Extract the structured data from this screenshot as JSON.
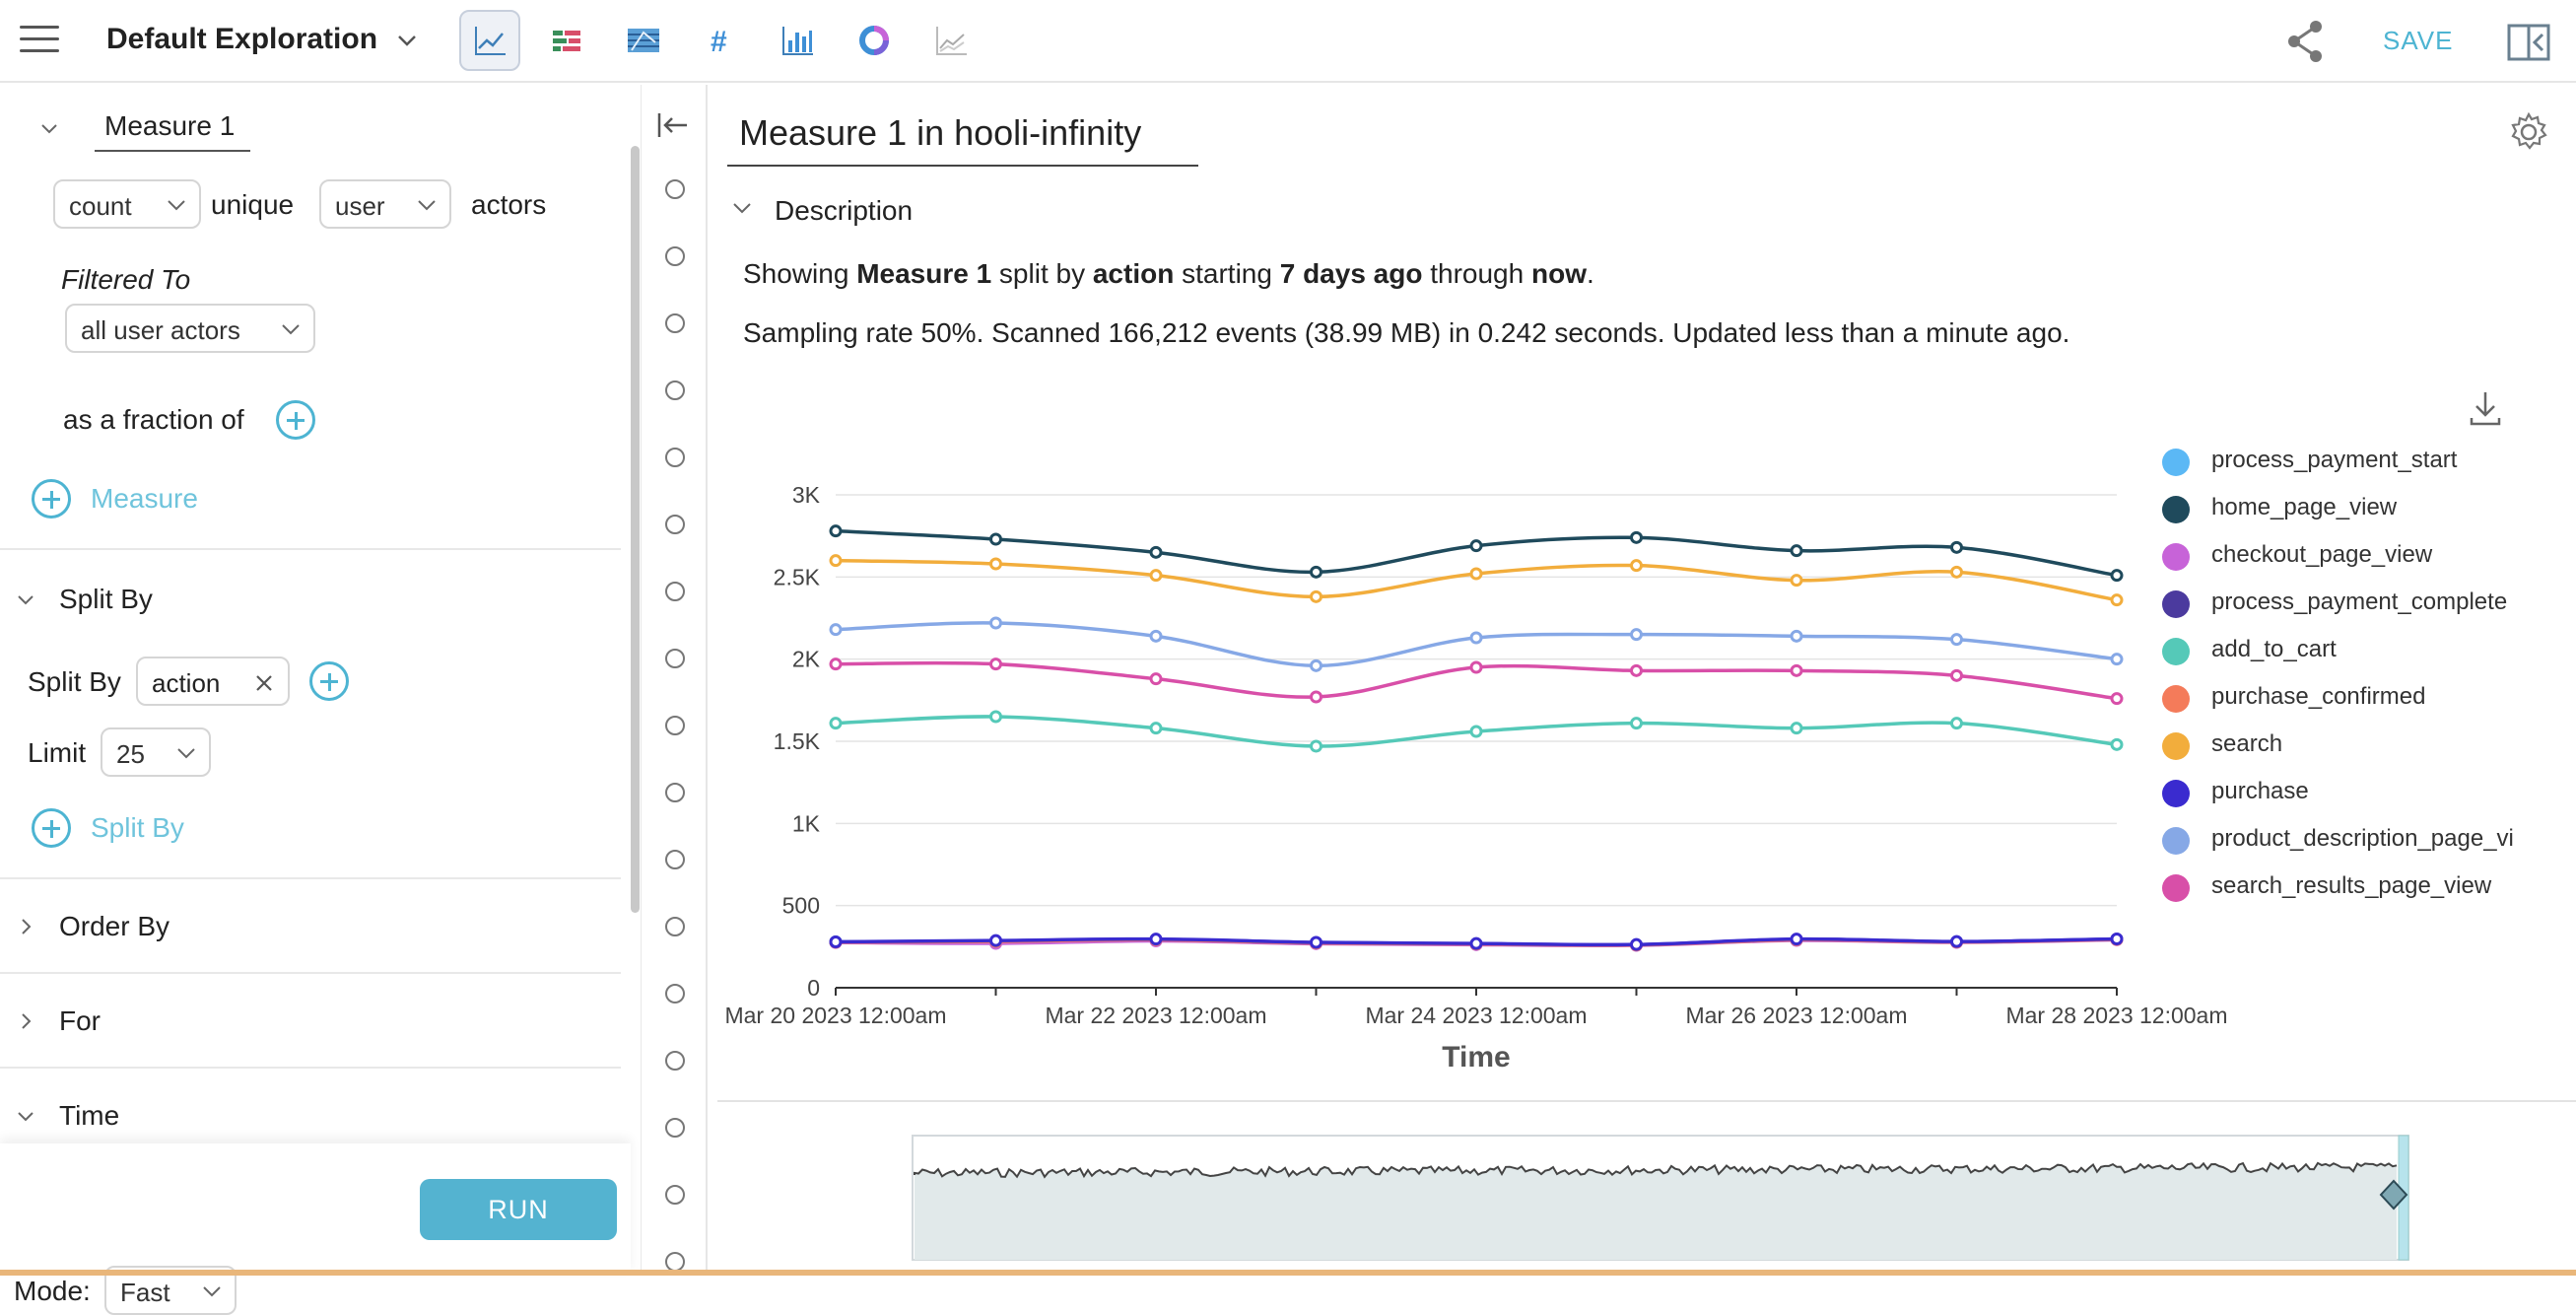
{
  "header": {
    "title": "Default Exploration",
    "save_label": "SAVE",
    "viz_icons": [
      "line-chart-icon",
      "stacked-bar-icon",
      "heatmap-icon",
      "number-icon",
      "bar-chart-icon",
      "donut-chart-icon",
      "sparkline-icon"
    ]
  },
  "left": {
    "measure_name": "Measure 1",
    "aggregation": "count",
    "unique_label": "unique",
    "actor_type": "user",
    "actors_label": "actors",
    "filtered_to_label": "Filtered To",
    "filter_value": "all user actors",
    "fraction_label": "as a fraction of",
    "add_measure_label": "Measure",
    "split_by_section": "Split By",
    "split_by_label": "Split By",
    "split_by_value": "action",
    "limit_label": "Limit",
    "limit_value": "25",
    "add_split_label": "Split By",
    "order_by_section": "Order By",
    "for_section": "For",
    "time_section": "Time",
    "mode_label": "Mode:",
    "mode_value": "Fast",
    "run_label": "RUN"
  },
  "main": {
    "title": "Measure 1 in hooli-infinity",
    "description_label": "Description",
    "desc_line1": {
      "p1": "Showing ",
      "measure": "Measure 1",
      "p2": " split by ",
      "split": "action",
      "p3": " starting ",
      "start": "7 days ago",
      "p4": " through ",
      "end": "now",
      "p5": "."
    },
    "desc_line2": "Sampling rate 50%. Scanned 166,212 events (38.99 MB) in 0.242 seconds. Updated less than a minute ago."
  },
  "colors": {
    "accent": "#4db4d2",
    "run_button": "#54b3d0"
  },
  "chart_data": {
    "type": "line",
    "xlabel": "Time",
    "ylabel": "",
    "ylim": [
      0,
      3000
    ],
    "yticks": [
      0,
      500,
      1000,
      1500,
      2000,
      2500,
      3000
    ],
    "ytick_labels": [
      "0",
      "500",
      "1K",
      "1.5K",
      "2K",
      "2.5K",
      "3K"
    ],
    "xticks": [
      "Mar 20 2023 12:00am",
      "Mar 22 2023 12:00am",
      "Mar 24 2023 12:00am",
      "Mar 26 2023 12:00am",
      "Mar 28 2023 12:00am"
    ],
    "x": [
      "Mar 20 2023 12:00am",
      "Mar 21 2023 12:00am",
      "Mar 22 2023 12:00am",
      "Mar 23 2023 12:00am",
      "Mar 24 2023 12:00am",
      "Mar 25 2023 12:00am",
      "Mar 26 2023 12:00am",
      "Mar 27 2023 12:00am",
      "Mar 28 2023 12:00am"
    ],
    "grid": true,
    "legend_position": "right",
    "series": [
      {
        "name": "process_payment_start",
        "color": "#5bb8f5",
        "values": [
          280,
          275,
          290,
          270,
          265,
          260,
          290,
          280,
          295
        ]
      },
      {
        "name": "home_page_view",
        "color": "#1f4a5c",
        "values": [
          2780,
          2730,
          2650,
          2530,
          2690,
          2740,
          2660,
          2680,
          2510
        ]
      },
      {
        "name": "checkout_page_view",
        "color": "#c763d8",
        "values": [
          275,
          270,
          285,
          268,
          262,
          258,
          288,
          276,
          292
        ]
      },
      {
        "name": "process_payment_complete",
        "color": "#4b3a9e",
        "values": [
          278,
          285,
          295,
          275,
          268,
          262,
          295,
          280,
          296
        ]
      },
      {
        "name": "add_to_cart",
        "color": "#55c9b8",
        "values": [
          1610,
          1650,
          1580,
          1470,
          1560,
          1610,
          1580,
          1610,
          1480
        ]
      },
      {
        "name": "purchase_confirmed",
        "color": "#f47b5a",
        "values": [
          277,
          282,
          292,
          272,
          266,
          260,
          292,
          278,
          294
        ]
      },
      {
        "name": "search",
        "color": "#f2ad3c",
        "values": [
          2600,
          2580,
          2510,
          2380,
          2520,
          2570,
          2480,
          2530,
          2360
        ]
      },
      {
        "name": "purchase",
        "color": "#3a2bcf",
        "values": [
          279,
          287,
          296,
          276,
          269,
          263,
          296,
          281,
          297
        ]
      },
      {
        "name": "product_description_page_vi",
        "color": "#86a8e6",
        "values": [
          2180,
          2220,
          2140,
          1960,
          2130,
          2150,
          2140,
          2120,
          2000
        ]
      },
      {
        "name": "search_results_page_view",
        "color": "#d84fa8",
        "values": [
          1970,
          1970,
          1880,
          1770,
          1950,
          1930,
          1930,
          1900,
          1760
        ]
      }
    ]
  }
}
